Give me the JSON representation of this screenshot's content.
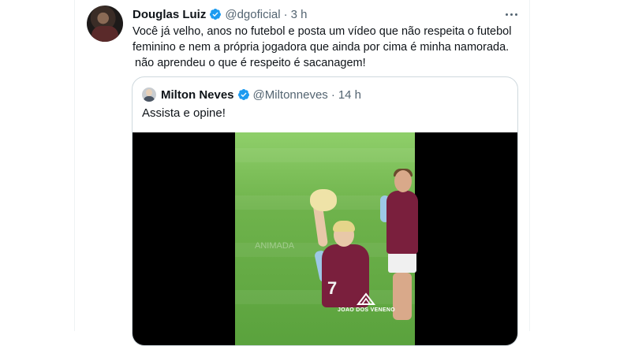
{
  "tweet": {
    "author_name": "Douglas Luiz",
    "handle": "@dgoficial",
    "separator": "·",
    "time": "3 h",
    "text_lines": [
      "Você já velho, anos no futebol e posta um vídeo que não respeita o futebol",
      "feminino e nem a própria jogadora que ainda por cima é minha namorada.",
      " não aprendeu o que é respeito é sacanagem!"
    ]
  },
  "quoted_tweet": {
    "author_name": "Milton Neves",
    "handle": "@Miltonneves",
    "separator": "·",
    "time": "14 h",
    "text": "Assista e opine!",
    "video_watermark": "ANIMADA",
    "video_logo_text": "JOAO DOS VENENO"
  },
  "colors": {
    "verified_badge": "#1d9bf0",
    "muted_text": "#536471",
    "card_border": "#cfd9de",
    "jersey": "#7a1f3d"
  },
  "icons": {
    "verified": "verified-badge-icon",
    "more": "more-horizontal-icon"
  }
}
